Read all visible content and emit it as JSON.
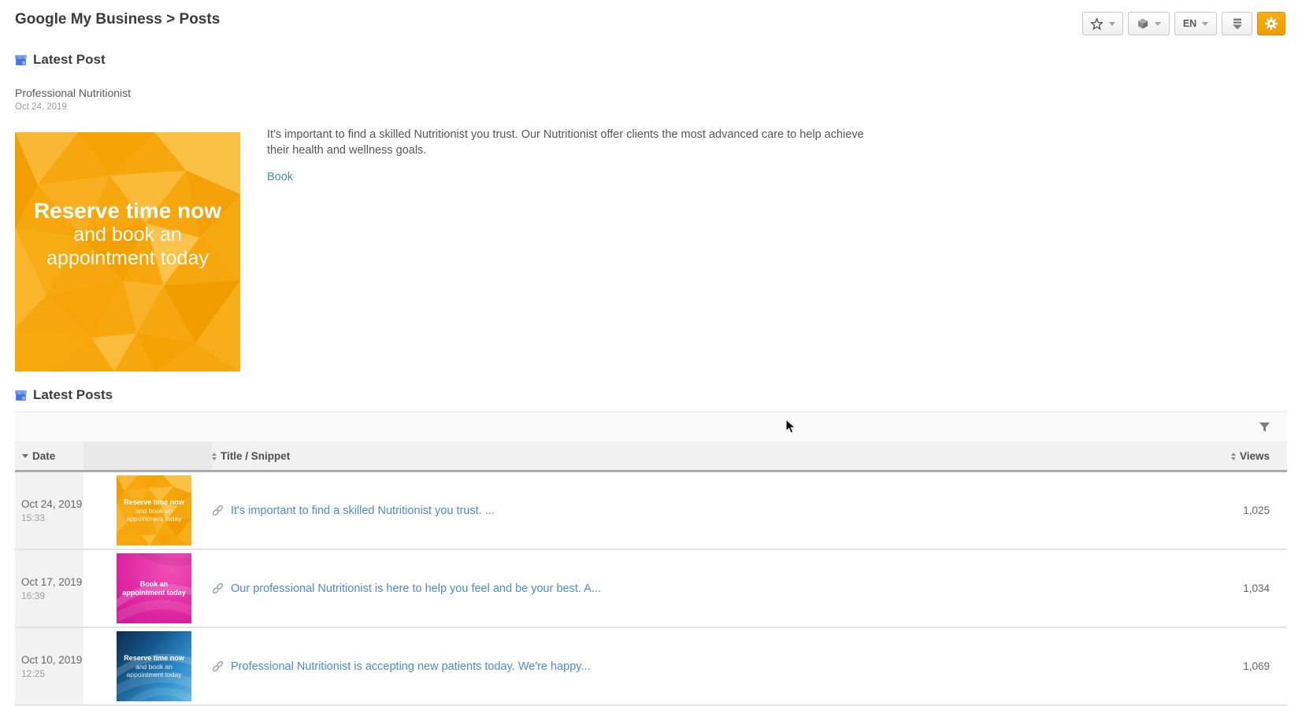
{
  "page": {
    "title": "Google My Business > Posts"
  },
  "toolbar": {
    "language_label": "EN",
    "icons": [
      "star-icon",
      "cube-icon",
      "language-dropdown",
      "download-icon",
      "gear-icon"
    ]
  },
  "colors": {
    "accent_orange": "#f0a00a",
    "link_blue": "#4a8bd4",
    "gmb_blue": "#4374e0",
    "thumb_orange": "#f6a70d",
    "thumb_pink": "#d6219c",
    "thumb_blue": "#2f8ec9"
  },
  "latest_post": {
    "section_title": "Latest Post",
    "post_title": "Professional Nutritionist",
    "post_date": "Oct 24, 2019",
    "image_lines": [
      "Reserve time now",
      "and book an",
      "appointment today"
    ],
    "body_lines": [
      "It's important to find a skilled Nutritionist you trust. Our Nutritionist offer clients the most advanced care to help achieve",
      "their health and wellness goals."
    ],
    "cta_label": "Book"
  },
  "latest_posts": {
    "section_title": "Latest Posts",
    "columns": {
      "date": "Date",
      "title": "Title / Snippet",
      "views": "Views"
    },
    "rows": [
      {
        "date": "Oct 24, 2019",
        "time": "15:33",
        "title": "It's important to find a skilled Nutritionist you trust. ...",
        "views": "1,025",
        "thumb_lines": [
          "Reserve time now",
          "and book an",
          "appointment today"
        ]
      },
      {
        "date": "Oct 17, 2019",
        "time": "16:39",
        "title": "Our professional Nutritionist is here to help you feel and be your best. A...",
        "views": "1,034",
        "thumb_lines": [
          "Book an",
          "appointment today",
          ""
        ]
      },
      {
        "date": "Oct 10, 2019",
        "time": "12:25",
        "title": "Professional Nutritionist is accepting new patients today. We're happy...",
        "views": "1,069",
        "thumb_lines": [
          "Reserve time now",
          "and book an",
          "appointment today"
        ]
      }
    ]
  }
}
